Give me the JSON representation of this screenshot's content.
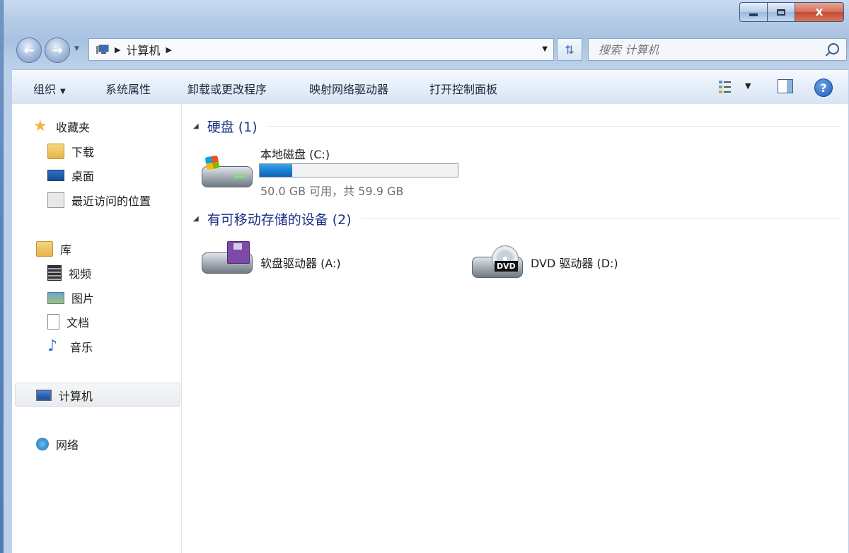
{
  "window": {
    "caption": {
      "close_label": "x"
    }
  },
  "nav": {
    "address": {
      "segment": "计算机"
    },
    "search": {
      "placeholder": "搜索 计算机"
    }
  },
  "toolbar": {
    "organize": "组织",
    "system_properties": "系统属性",
    "uninstall": "卸载或更改程序",
    "map_drive": "映射网络驱动器",
    "control_panel": "打开控制面板",
    "help_label": "?"
  },
  "sidebar": {
    "favorites": {
      "label": "收藏夹",
      "icon": "star-icon",
      "items": [
        {
          "label": "下载",
          "icon": "downloads-folder-icon"
        },
        {
          "label": "桌面",
          "icon": "desktop-icon"
        },
        {
          "label": "最近访问的位置",
          "icon": "recent-places-icon"
        }
      ]
    },
    "libraries": {
      "label": "库",
      "icon": "library-icon",
      "items": [
        {
          "label": "视频",
          "icon": "video-icon"
        },
        {
          "label": "图片",
          "icon": "pictures-icon"
        },
        {
          "label": "文档",
          "icon": "documents-icon"
        },
        {
          "label": "音乐",
          "icon": "music-icon"
        }
      ]
    },
    "computer": {
      "label": "计算机",
      "icon": "computer-icon",
      "selected": true
    },
    "network": {
      "label": "网络",
      "icon": "network-icon"
    }
  },
  "content": {
    "hard_disks": {
      "title": "硬盘 (1)",
      "drives": [
        {
          "name": "本地磁盘 (C:)",
          "free_text": "50.0 GB 可用，共 59.9 GB",
          "free_gb": 50.0,
          "total_gb": 59.9,
          "used_fraction": 0.165,
          "bar_color": "#1c7fd0"
        }
      ]
    },
    "removable": {
      "title": "有可移动存储的设备 (2)",
      "drives": [
        {
          "name": "软盘驱动器 (A:)",
          "icon": "floppy-drive-icon"
        },
        {
          "name": "DVD 驱动器 (D:)",
          "icon": "dvd-drive-icon",
          "badge": "DVD"
        }
      ]
    }
  }
}
